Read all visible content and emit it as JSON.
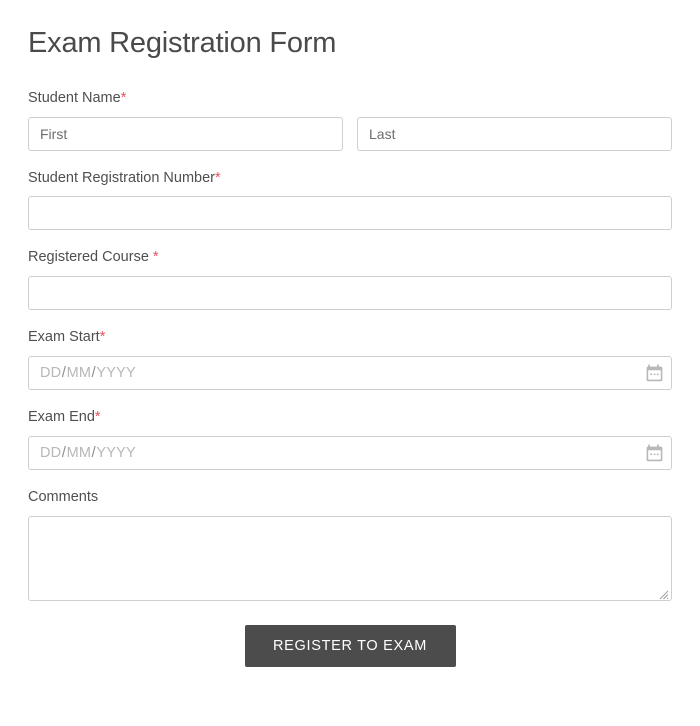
{
  "form": {
    "title": "Exam Registration Form",
    "required_marker": "*",
    "accent_required_color": "#e8525f",
    "submit_button_color": "#4c4c4c",
    "border_color": "#cfcfcf",
    "label_color": "#4f4f4f"
  },
  "fields": {
    "student_name": {
      "label": "Student Name",
      "required": true,
      "first": {
        "placeholder": "First",
        "value": ""
      },
      "last": {
        "placeholder": "Last",
        "value": ""
      }
    },
    "registration_number": {
      "label": "Student Registration Number",
      "required": true,
      "placeholder": "",
      "value": ""
    },
    "registered_course": {
      "label": "Registered Course",
      "required": true,
      "placeholder": "",
      "value": ""
    },
    "exam_start": {
      "label": "Exam Start",
      "required": true,
      "placeholder_day": "DD",
      "placeholder_sep1": "/",
      "placeholder_month": "MM",
      "placeholder_sep2": "/",
      "placeholder_year": "YYYY",
      "value": "",
      "icon": "calendar-icon"
    },
    "exam_end": {
      "label": "Exam End",
      "required": true,
      "placeholder_day": "DD",
      "placeholder_sep1": "/",
      "placeholder_month": "MM",
      "placeholder_sep2": "/",
      "placeholder_year": "YYYY",
      "value": "",
      "icon": "calendar-icon"
    },
    "comments": {
      "label": "Comments",
      "required": false,
      "placeholder": "",
      "value": ""
    }
  },
  "actions": {
    "submit_label": "Register to Exam"
  }
}
